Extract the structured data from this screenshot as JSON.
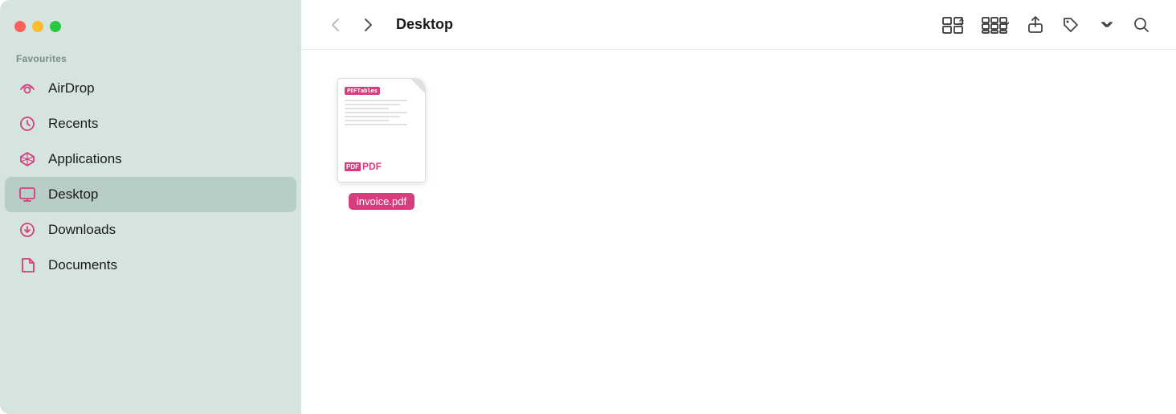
{
  "window": {
    "title": "Desktop"
  },
  "controls": {
    "close_label": "",
    "minimize_label": "",
    "maximize_label": ""
  },
  "sidebar": {
    "section_label": "Favourites",
    "items": [
      {
        "id": "airdrop",
        "label": "AirDrop",
        "icon": "airdrop",
        "active": false
      },
      {
        "id": "recents",
        "label": "Recents",
        "icon": "recents",
        "active": false
      },
      {
        "id": "applications",
        "label": "Applications",
        "icon": "applications",
        "active": false
      },
      {
        "id": "desktop",
        "label": "Desktop",
        "icon": "desktop",
        "active": true
      },
      {
        "id": "downloads",
        "label": "Downloads",
        "icon": "downloads",
        "active": false
      },
      {
        "id": "documents",
        "label": "Documents",
        "icon": "documents",
        "active": false
      }
    ]
  },
  "toolbar": {
    "back_label": "‹",
    "forward_label": "›",
    "title": "Desktop",
    "view_grid_label": "⊞",
    "view_group_label": "⊟",
    "share_label": "↑",
    "tag_label": "◇",
    "more_label": "»",
    "search_label": "⌕"
  },
  "files": [
    {
      "id": "invoice-pdf",
      "name": "invoice.pdf",
      "type": "pdf",
      "label_bg": "#d63c7e",
      "label_color": "#ffffff"
    }
  ]
}
